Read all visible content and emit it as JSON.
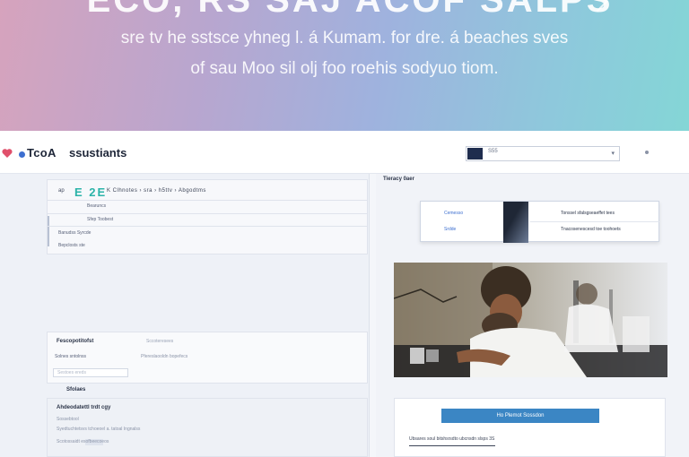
{
  "hero": {
    "title": "ECO, RS SAJ ACOF SALPS",
    "subtitle_1": "sre tv he sstsce yhneg l. á Kumam. for dre. á beaches sves",
    "subtitle_2": "of sau Moo sil olj foo roehis sodyuo tiom."
  },
  "topbar": {
    "brand": "TcoA",
    "brand_sub": "ssustiants",
    "search_value": "S55"
  },
  "left": {
    "card1": {
      "ap_label": "ap",
      "badge": "E 2E",
      "toolbar": "K Clhnotes  ›  sra  ›  h5ttv  ›  Abgodtms",
      "item_1": "Bearuncs",
      "item_2": "Sfep Toobest",
      "item_3": "Banudss Syrcde",
      "item_4": "Bepclosts ste"
    },
    "card2": {
      "title": "Fescopotitofst",
      "tag": "Sccoteresees",
      "row_left": "Solnes sntolnss",
      "row_right": "Pfereslaooldn bopefecs",
      "input_placeholder": "Sestoes ereds"
    },
    "section_label": "Sfolaes",
    "card3": {
      "title": "Ahdeodatettl trdt cgy",
      "line_1": "Sossebtool",
      "line_2": "Syedtuchtetsvs tchoeoel a. tatoal Ingnalss",
      "line_3": "Scotossaidt  esofbeecoeos"
    }
  },
  "right": {
    "title": "Tieracy  0aer",
    "popup": {
      "line_1": "Cemesso",
      "line_2": "Srdde",
      "line_3": "Tonssel sfalsgseaeffet tees",
      "line_4": "Tnacosenescesd toe toohoets"
    },
    "cta_label": "Ho Plemot Sossdon",
    "footer_text": "Ubsares soul bitshsrsdto ubcnsdn slsps 3S"
  },
  "colors": {
    "accent": "#3b86c4",
    "badge_teal": "#2bb3a8",
    "hero_pink": "#d6a3bd",
    "hero_teal": "#84d6d6"
  },
  "icons": {
    "logo": "heart-icon",
    "search_flag": "flag-icon",
    "search_dropdown": "chevron-down-icon",
    "hero_arrow": "chevron-right-icon"
  }
}
